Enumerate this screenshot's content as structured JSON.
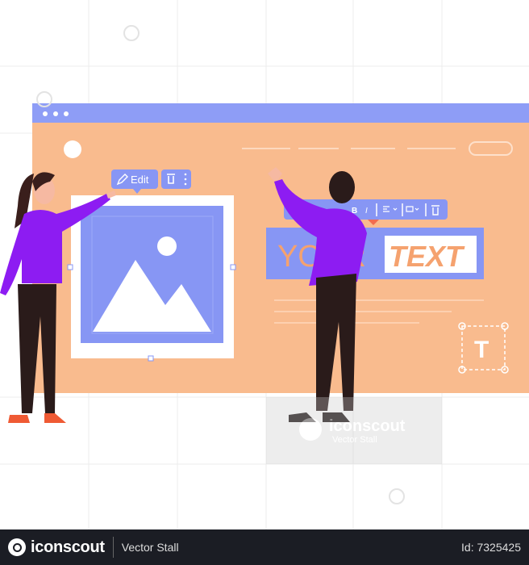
{
  "colors": {
    "browser_bar": "#8e9df6",
    "page_bg": "#f9bb8e",
    "accent_purple": "#8d1cf2",
    "image_blue": "#8796f4",
    "text_orange": "#f5a26f",
    "footer_bg": "#1b1d24"
  },
  "image_toolbar": {
    "edit_label": "Edit",
    "edit_icon": "pencil-icon",
    "delete_icon": "trash-icon",
    "more_icon": "kebab-icon"
  },
  "text_toolbar": {
    "bold": "B",
    "italic": "I",
    "align_icon": "align-left-icon",
    "link_icon": "link-icon",
    "delete_icon": "trash-icon"
  },
  "headline": {
    "word1": "YOUR",
    "word2": "TEXT"
  },
  "text_tool": {
    "label": "T"
  },
  "watermark": {
    "brand": "iconscout",
    "author": "Vector Stall"
  },
  "footer": {
    "brand": "iconscout",
    "author": "Vector Stall",
    "id": "Id: 7325425"
  }
}
